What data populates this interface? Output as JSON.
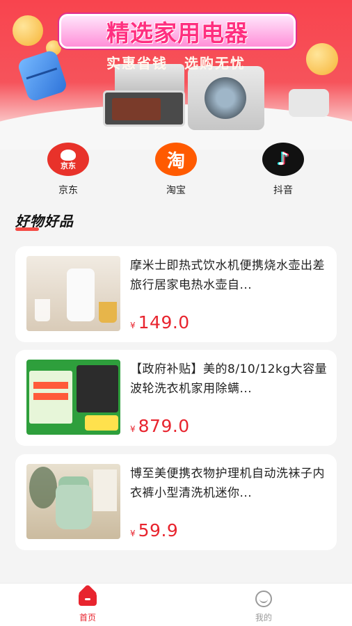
{
  "banner": {
    "title": "精选家用电器",
    "subtitle_left": "实惠省钱",
    "subtitle_right": "选购无忧"
  },
  "platforms": [
    {
      "name": "京东",
      "icon": "jd-logo-icon",
      "logo_text": "京东",
      "color": "#e8322a"
    },
    {
      "name": "淘宝",
      "icon": "taobao-logo-icon",
      "logo_text": "淘",
      "color": "#ff5a00"
    },
    {
      "name": "抖音",
      "icon": "douyin-logo-icon",
      "logo_text": "♪",
      "color": "#111111"
    }
  ],
  "section": {
    "title": "好物好品"
  },
  "products": [
    {
      "title": "摩米士即热式饮水机便携烧水壶出差旅行居家电热水壶自...",
      "currency": "¥",
      "price": "149.0"
    },
    {
      "title": "【政府补贴】美的8/10/12kg大容量波轮洗衣机家用除螨...",
      "currency": "¥",
      "price": "879.0"
    },
    {
      "title": "博至美便携衣物护理机自动洗袜子内衣裤小型清洗机迷你...",
      "currency": "¥",
      "price": "59.9"
    }
  ],
  "tabbar": {
    "home": {
      "label": "首页",
      "icon": "home-icon"
    },
    "mine": {
      "label": "我的",
      "icon": "user-icon"
    }
  },
  "colors": {
    "accent": "#e8242e",
    "banner": "#f6535b",
    "inactive": "#9a9a9a"
  }
}
